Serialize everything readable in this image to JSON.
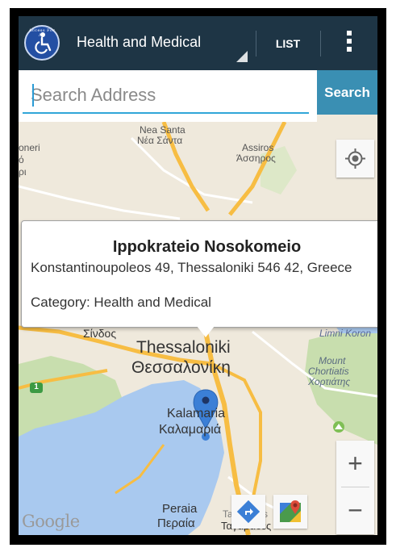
{
  "app": {
    "logo": "Access For All",
    "category_selected": "Health and Medical",
    "list_label": "LIST",
    "overflow_icon": "overflow-menu-icon"
  },
  "search": {
    "placeholder": "Search Address",
    "value": "",
    "button_label": "Search"
  },
  "info_window": {
    "title": "Ippokrateio Nosokomeio",
    "address": "Konstantinoupoleos 49, Thessaloniki 546 42, Greece",
    "category": "Category: Health and Medical"
  },
  "map": {
    "labels": {
      "nea_santa_en": "Nea Santa",
      "nea_santa_gr": "Νέα Σάντα",
      "assiros_en": "Assiros",
      "assiros_gr": "Άσσηρος",
      "left_edge_1": "oneri",
      "left_edge_2": "ό",
      "left_edge_3": "ρι",
      "sindos": "Σίνδος",
      "limni_koroneia": "Limni Koron",
      "thessaloniki_en": "Thessaloniki",
      "thessaloniki_gr": "Θεσσαλονίκη",
      "mount_chortiatis_1": "Mount",
      "mount_chortiatis_2": "Chortiatis",
      "mount_chortiatis_3": "Χορτιάτης",
      "kalamaria_en": "Kalamaria",
      "kalamaria_gr": "Καλαμαριά",
      "peraia_en": "Peraia",
      "peraia_gr": "Περαία",
      "tagarades_en": "Tagarades",
      "tagarades_gr": "Ταγαράδες",
      "highway_shield": "1",
      "attribution": "Google"
    },
    "controls": {
      "zoom_in": "+",
      "zoom_out": "−",
      "locate_icon": "my-location-icon",
      "directions_icon": "directions-icon",
      "maps_icon": "google-maps-icon"
    },
    "colors": {
      "land": "#efe9dc",
      "water": "#a9c9ef",
      "park": "#c8deae",
      "road_major": "#f7bd43",
      "road_minor": "#ffffff",
      "marker": "#3b7fd6"
    }
  }
}
